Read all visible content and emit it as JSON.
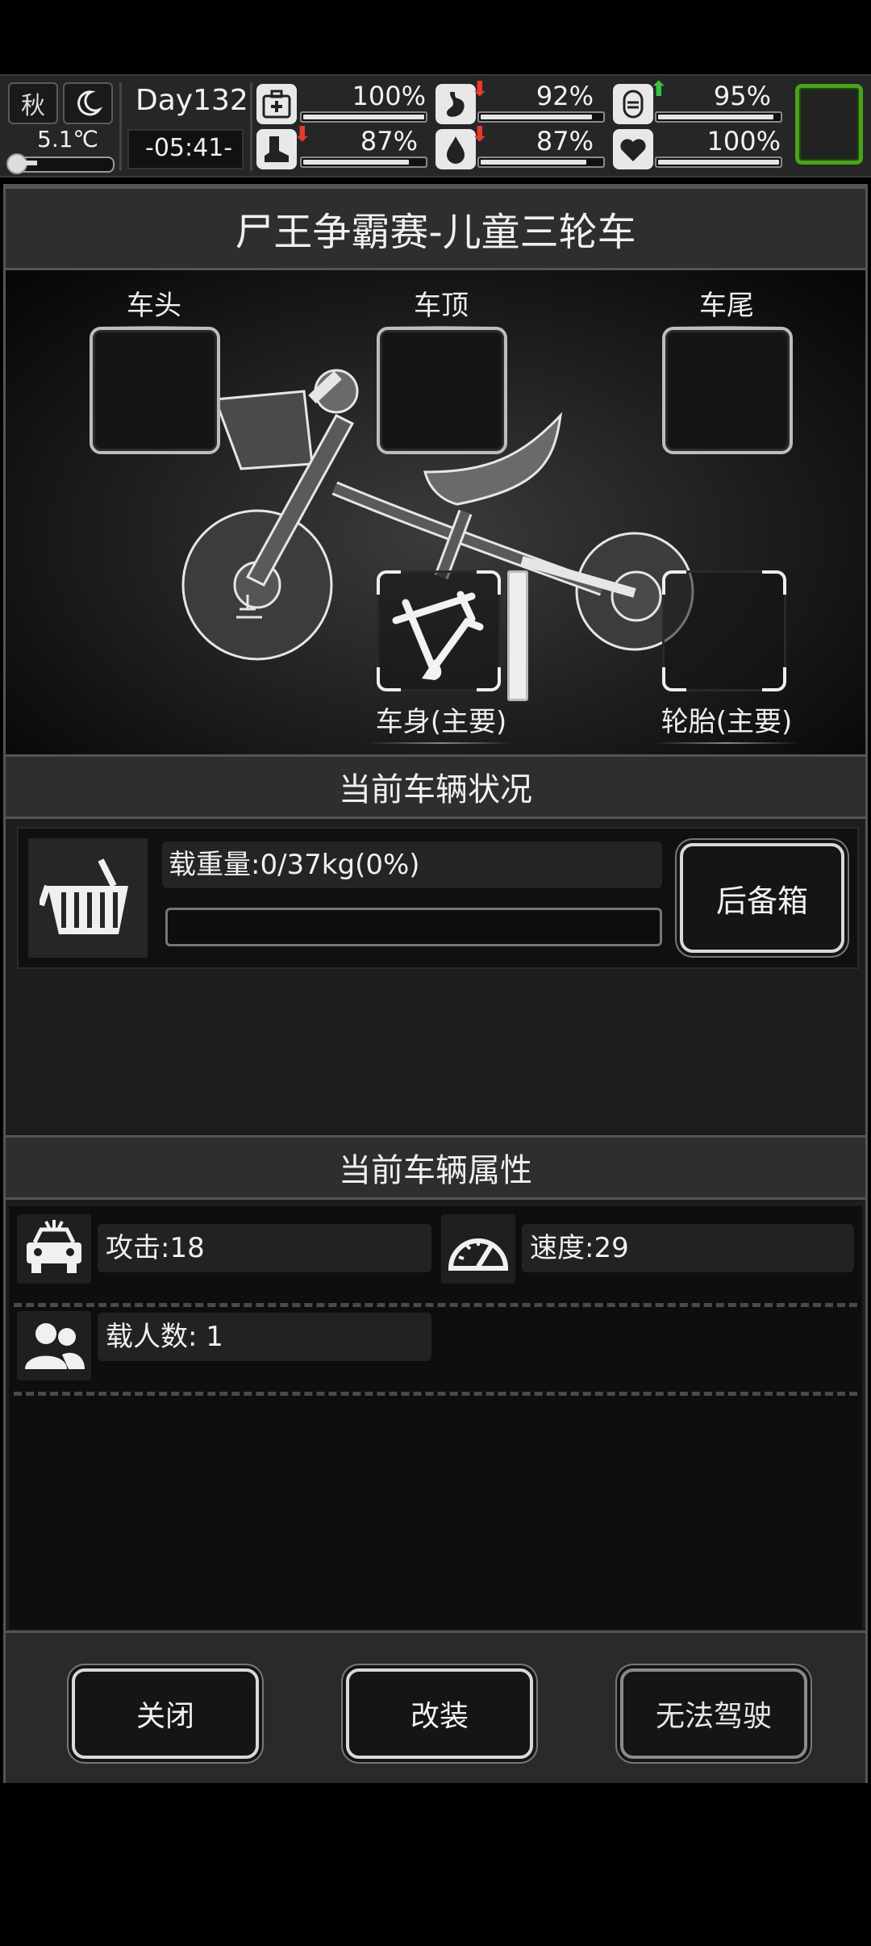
{
  "hud": {
    "season": "秋",
    "temperature": "5.1℃",
    "day": "Day132",
    "time": "-05:41-",
    "stats": [
      {
        "name": "health",
        "value": "100%",
        "fill": 1.0,
        "trend": ""
      },
      {
        "name": "hunger",
        "value": "92%",
        "fill": 0.92,
        "trend": "down"
      },
      {
        "name": "mood",
        "value": "95%",
        "fill": 0.95,
        "trend": "up"
      },
      {
        "name": "stamina",
        "value": "87%",
        "fill": 0.87,
        "trend": "down"
      },
      {
        "name": "thirst",
        "value": "87%",
        "fill": 0.87,
        "trend": "down"
      },
      {
        "name": "spirit",
        "value": "100%",
        "fill": 1.0,
        "trend": ""
      }
    ]
  },
  "vehicle": {
    "title": "尸王争霸赛-儿童三轮车",
    "slots": {
      "head": "车头",
      "roof": "车顶",
      "tail": "车尾",
      "body": "车身(主要)",
      "tire": "轮胎(主要)"
    }
  },
  "status": {
    "header": "当前车辆状况",
    "load_label": "载重量:0/37kg(0%)",
    "load_fill": 0.0,
    "trunk_button": "后备箱"
  },
  "attributes": {
    "header": "当前车辆属性",
    "attack": "攻击:18",
    "speed": "速度:29",
    "passengers": "载人数: 1"
  },
  "footer": {
    "close": "关闭",
    "modify": "改装",
    "drive": "无法驾驶"
  }
}
